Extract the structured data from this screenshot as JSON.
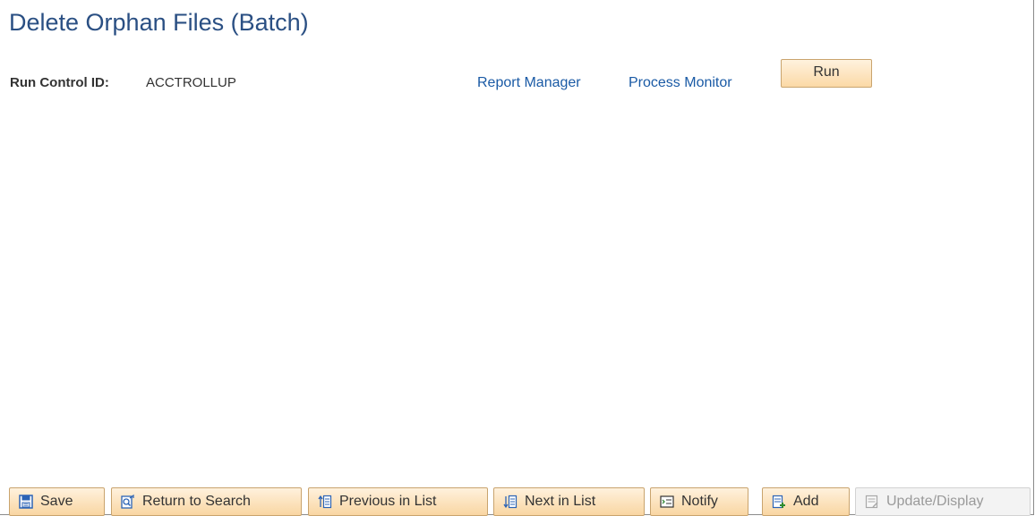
{
  "page": {
    "title": "Delete Orphan Files (Batch)"
  },
  "run_control": {
    "label": "Run Control ID:",
    "value": "ACCTROLLUP"
  },
  "links": {
    "report_manager": "Report Manager",
    "process_monitor": "Process Monitor"
  },
  "run_button": "Run",
  "toolbar": {
    "save": "Save",
    "return_to_search": "Return to Search",
    "previous_in_list": "Previous in List",
    "next_in_list": "Next in List",
    "notify": "Notify",
    "add": "Add",
    "update_display": "Update/Display"
  },
  "icons": {
    "save": "save-icon",
    "return_to_search": "search-return-icon",
    "previous_in_list": "previous-list-icon",
    "next_in_list": "next-list-icon",
    "notify": "notify-icon",
    "add": "add-icon",
    "update_display": "update-display-icon"
  },
  "colors": {
    "title": "#2a4f83",
    "link": "#1a5aa5",
    "button_top": "#fff1dd",
    "button_bottom": "#f9d6a2",
    "button_border": "#c9a46e",
    "disabled_text": "#9a9a9a"
  }
}
